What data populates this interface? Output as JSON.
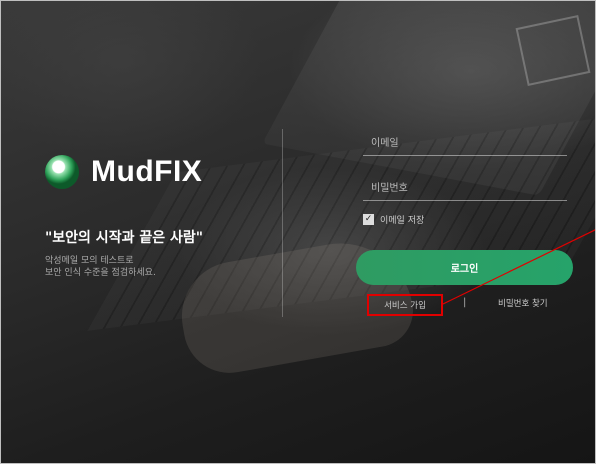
{
  "brand": {
    "name": "MudFIX"
  },
  "left": {
    "tagline": "\"보안의 시작과 끝은 사람\"",
    "desc_line1": "악성메일 모의 테스트로",
    "desc_line2": "보안 인식 수준을 점검하세요."
  },
  "form": {
    "email_placeholder": "이메일",
    "password_placeholder": "비밀번호",
    "remember_label": "이메일 저장",
    "remember_checked": true,
    "login_label": "로그인",
    "signup_label": "서비스 가입",
    "separator": "|",
    "find_password_label": "비밀번호 찾기"
  },
  "colors": {
    "accent": "#2f9b62",
    "highlight": "#e10000"
  }
}
